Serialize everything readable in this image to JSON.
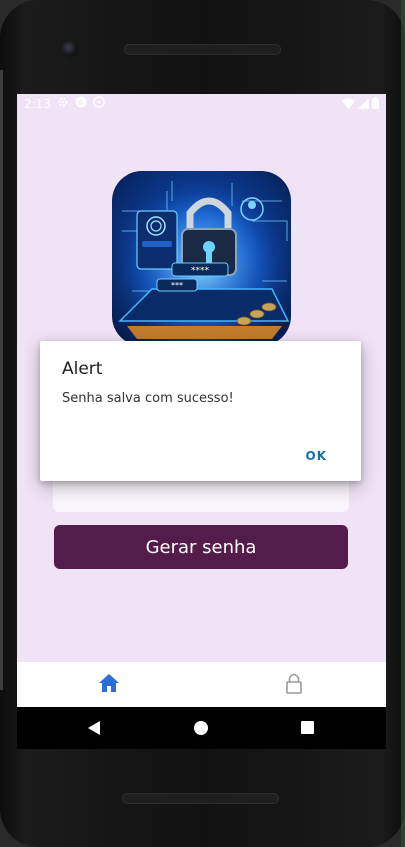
{
  "status_bar": {
    "time": "2:13"
  },
  "icons": {
    "settings": "gear-icon",
    "sync": "sync-icon",
    "wifi": "wifi-icon",
    "signal": "signal-icon",
    "battery": "battery-icon",
    "home": "home-icon",
    "lock": "lock-icon"
  },
  "main": {
    "generate_button_label": "Gerar senha"
  },
  "dialog": {
    "title": "Alert",
    "message": "Senha salva com sucesso!",
    "ok_label": "OK"
  },
  "colors": {
    "background": "#f0e3f5",
    "button": "#541c4a",
    "active_tab": "#2b6fd6",
    "dialog_action": "#1b6fa3"
  }
}
